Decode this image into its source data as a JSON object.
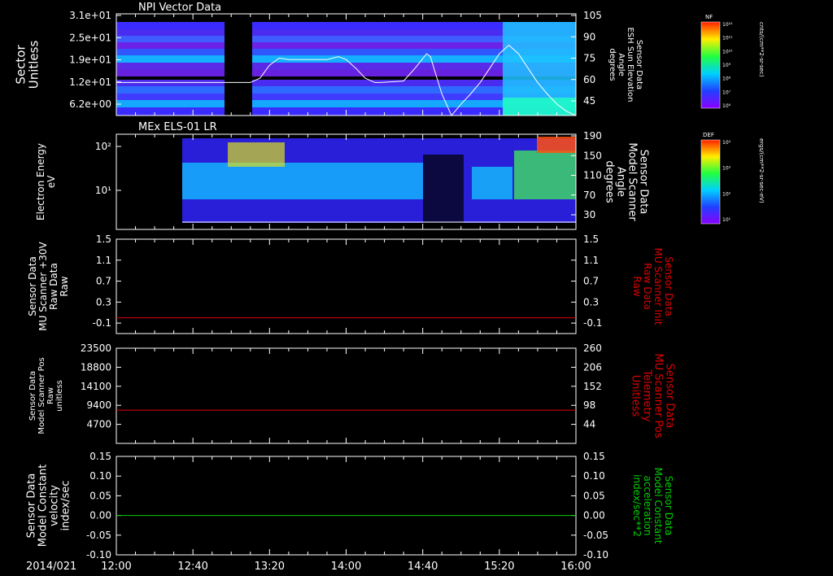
{
  "chart_data": [
    {
      "type": "heatmap",
      "title": "NPI Vector Data",
      "ylabel": [
        "Sector",
        "Unitless"
      ],
      "yticks": [
        "3.1e+01",
        "2.5e+01",
        "1.9e+01",
        "1.2e+01",
        "6.2e+00"
      ],
      "right_label": [
        "Sensor Data",
        "ESH Sun Elevation",
        "Angle",
        "degrees"
      ],
      "right_ticks": [
        "105",
        "90",
        "75",
        "60",
        "45"
      ],
      "overlay_line": {
        "x_minutes": [
          0,
          40,
          70,
          75,
          80,
          85,
          90,
          95,
          100,
          110,
          116,
          120,
          125,
          130,
          135,
          138,
          150,
          156,
          162,
          164,
          167,
          170,
          175,
          180,
          185,
          190,
          195,
          200,
          205,
          210,
          215,
          220,
          225,
          230,
          235,
          240
        ],
        "y_degrees": [
          60,
          60,
          60,
          63,
          72,
          77,
          76,
          76,
          76,
          76,
          78,
          76,
          70,
          63,
          60,
          60,
          61,
          70,
          80,
          78,
          65,
          52,
          37,
          45,
          52,
          60,
          70,
          80,
          86,
          80,
          70,
          60,
          52,
          45,
          40,
          37
        ]
      },
      "colorbar": {
        "label": "NF",
        "unit": "cnts/(cm**2-sr-sec)",
        "ticks": [
          "10¹²",
          "10¹¹",
          "10¹⁰",
          "10⁹",
          "10⁸",
          "10⁷",
          "10⁶"
        ]
      }
    },
    {
      "type": "heatmap",
      "title": "MEx ELS-01 LR",
      "ylabel": [
        "Electron Energy",
        "eV"
      ],
      "yticks": [
        "10²",
        "10¹"
      ],
      "right_label": [
        "Sensor Data",
        "Model Scanner",
        "Angle",
        "degrees"
      ],
      "right_ticks": [
        "190",
        "150",
        "110",
        "70",
        "30"
      ],
      "colorbar": {
        "label": "DEF",
        "unit": "ergs/(cm**2-sr-sec-eV)",
        "ticks": [
          "10⁴",
          "10³",
          "10²",
          "10¹"
        ]
      }
    },
    {
      "type": "line",
      "ylabel": [
        "Sensor Data",
        "MU Scanner +30V",
        "Raw Data",
        "Raw"
      ],
      "yticks": [
        "1.5",
        "1.1",
        "0.7",
        "0.3",
        "-0.1"
      ],
      "right_label": [
        "Sensor Data",
        "MU Scanner Init",
        "Raw Data",
        "Raw"
      ],
      "right_ticks": [
        "1.5",
        "1.1",
        "0.7",
        "0.3",
        "-0.1"
      ],
      "ylim": [
        -0.3,
        1.5
      ],
      "series": [
        {
          "values": [
            0.0,
            0.0
          ],
          "color": "#e00000"
        }
      ]
    },
    {
      "type": "line",
      "ylabel": [
        "Sensor Data",
        "Model Scanner Pos",
        "Raw",
        "unitless"
      ],
      "yticks": [
        "23500",
        "18800",
        "14100",
        "9400",
        "4700"
      ],
      "right_label": [
        "Sensor Data",
        "MU Scanner Pos",
        "Telemetry",
        "Unitless"
      ],
      "right_ticks": [
        "260",
        "206",
        "152",
        "98",
        "44"
      ],
      "ylim": [
        0,
        23500
      ],
      "series": [
        {
          "values": [
            8200,
            8200
          ],
          "color": "#e00000"
        }
      ]
    },
    {
      "type": "line",
      "ylabel": [
        "Sensor Data",
        "Model Constant",
        "velocity",
        "index/sec"
      ],
      "yticks": [
        "0.15",
        "0.10",
        "0.05",
        "0.00",
        "-0.05",
        "-0.10"
      ],
      "right_label": [
        "Sensor Data",
        "Model Constant",
        "acceleration",
        "index/sec**2"
      ],
      "right_ticks": [
        "0.15",
        "0.10",
        "0.05",
        "0.00",
        "-0.05",
        "-0.10"
      ],
      "ylim": [
        -0.1,
        0.15
      ],
      "series": [
        {
          "values": [
            0.0,
            0.0
          ],
          "color": "#00d000"
        }
      ]
    }
  ],
  "xaxis": {
    "date": "2014/021",
    "ticks": [
      "12:00",
      "12:40",
      "13:20",
      "14:00",
      "14:40",
      "15:20",
      "16:00"
    ]
  },
  "colors": {
    "label_red": "#e00000",
    "label_green": "#00d000",
    "axis": "#ffffff"
  }
}
